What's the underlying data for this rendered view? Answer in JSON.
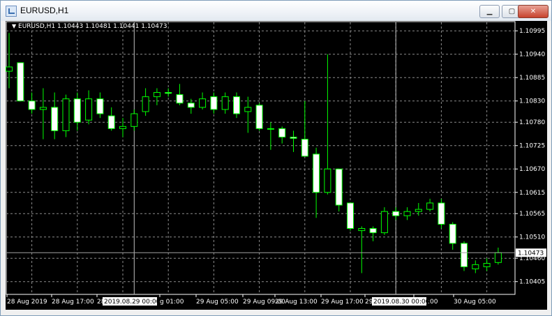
{
  "window": {
    "title": "EURUSD,H1",
    "buttons": {
      "minimize": "▁",
      "maximize": "▢",
      "close": "✕"
    }
  },
  "chart_header": {
    "label": "EURUSD,H1  1.10443 1.10481 1.10441 1.10473"
  },
  "colors": {
    "background": "#000000",
    "grid": "#8c8c8c",
    "bull": "#00ff00",
    "bull_fill": "#000000",
    "bear_fill": "#ffffff",
    "text": "#ffffff"
  },
  "chart_data": {
    "type": "candlestick",
    "symbol": "EURUSD",
    "timeframe": "H1",
    "ylim": [
      1.10375,
      1.11015
    ],
    "y_ticks": [
      "1.10995",
      "1.10940",
      "1.10885",
      "1.10830",
      "1.10780",
      "1.10725",
      "1.10670",
      "1.10615",
      "1.10565",
      "1.10510",
      "1.10460",
      "1.10405"
    ],
    "x_labels": [
      "28 Aug 2019",
      "28 Aug 17:00",
      "28",
      "g 01:00",
      "29 Aug 05:00",
      "29 Aug 09:00",
      "29 Aug 13:00",
      "29 Aug 17:00",
      "29",
      "g 01:00",
      "30 Aug 05:00"
    ],
    "crosshair_labels": [
      "2019.08.29 00:00",
      "2019.08.30 00:00"
    ],
    "current_price": "1.10473",
    "candles": [
      {
        "o": 1.109,
        "h": 1.1099,
        "l": 1.1086,
        "c": 1.1091
      },
      {
        "o": 1.1092,
        "h": 1.1092,
        "l": 1.1083,
        "c": 1.1083
      },
      {
        "o": 1.1083,
        "h": 1.1085,
        "l": 1.108,
        "c": 1.1081
      },
      {
        "o": 1.1081,
        "h": 1.1086,
        "l": 1.1074,
        "c": 1.10815
      },
      {
        "o": 1.10815,
        "h": 1.1085,
        "l": 1.1074,
        "c": 1.1076
      },
      {
        "o": 1.1076,
        "h": 1.10845,
        "l": 1.10745,
        "c": 1.10835
      },
      {
        "o": 1.10835,
        "h": 1.1085,
        "l": 1.1076,
        "c": 1.1078
      },
      {
        "o": 1.10785,
        "h": 1.10855,
        "l": 1.10775,
        "c": 1.10835
      },
      {
        "o": 1.10835,
        "h": 1.1085,
        "l": 1.1079,
        "c": 1.108
      },
      {
        "o": 1.10795,
        "h": 1.10815,
        "l": 1.1076,
        "c": 1.10765
      },
      {
        "o": 1.10765,
        "h": 1.1079,
        "l": 1.10745,
        "c": 1.1077
      },
      {
        "o": 1.1077,
        "h": 1.1081,
        "l": 1.1076,
        "c": 1.108
      },
      {
        "o": 1.10805,
        "h": 1.1086,
        "l": 1.10795,
        "c": 1.1084
      },
      {
        "o": 1.1084,
        "h": 1.1086,
        "l": 1.1082,
        "c": 1.1085
      },
      {
        "o": 1.1085,
        "h": 1.1086,
        "l": 1.1084,
        "c": 1.10848
      },
      {
        "o": 1.10845,
        "h": 1.1087,
        "l": 1.1082,
        "c": 1.10825
      },
      {
        "o": 1.10825,
        "h": 1.10835,
        "l": 1.108,
        "c": 1.10815
      },
      {
        "o": 1.10815,
        "h": 1.1085,
        "l": 1.1081,
        "c": 1.10835
      },
      {
        "o": 1.1084,
        "h": 1.1085,
        "l": 1.108,
        "c": 1.1081
      },
      {
        "o": 1.1081,
        "h": 1.1085,
        "l": 1.108,
        "c": 1.1084
      },
      {
        "o": 1.1084,
        "h": 1.1085,
        "l": 1.1079,
        "c": 1.108
      },
      {
        "o": 1.10805,
        "h": 1.1084,
        "l": 1.10755,
        "c": 1.10815
      },
      {
        "o": 1.1082,
        "h": 1.10825,
        "l": 1.1076,
        "c": 1.10765
      },
      {
        "o": 1.10765,
        "h": 1.1078,
        "l": 1.10715,
        "c": 1.10765
      },
      {
        "o": 1.10765,
        "h": 1.1077,
        "l": 1.1073,
        "c": 1.10745
      },
      {
        "o": 1.10745,
        "h": 1.1076,
        "l": 1.1071,
        "c": 1.10742
      },
      {
        "o": 1.1074,
        "h": 1.1083,
        "l": 1.107,
        "c": 1.107
      },
      {
        "o": 1.10705,
        "h": 1.1072,
        "l": 1.10555,
        "c": 1.10615
      },
      {
        "o": 1.10615,
        "h": 1.1094,
        "l": 1.1061,
        "c": 1.1067
      },
      {
        "o": 1.1067,
        "h": 1.1067,
        "l": 1.1057,
        "c": 1.10585
      },
      {
        "o": 1.1059,
        "h": 1.1059,
        "l": 1.10525,
        "c": 1.1053
      },
      {
        "o": 1.10525,
        "h": 1.10535,
        "l": 1.10425,
        "c": 1.1053
      },
      {
        "o": 1.1053,
        "h": 1.10535,
        "l": 1.105,
        "c": 1.1052
      },
      {
        "o": 1.1052,
        "h": 1.1058,
        "l": 1.10515,
        "c": 1.1057
      },
      {
        "o": 1.1057,
        "h": 1.1058,
        "l": 1.1055,
        "c": 1.1056
      },
      {
        "o": 1.1056,
        "h": 1.1058,
        "l": 1.1055,
        "c": 1.1057
      },
      {
        "o": 1.1057,
        "h": 1.1059,
        "l": 1.1056,
        "c": 1.10575
      },
      {
        "o": 1.10575,
        "h": 1.106,
        "l": 1.1057,
        "c": 1.1059
      },
      {
        "o": 1.1059,
        "h": 1.106,
        "l": 1.1053,
        "c": 1.1054
      },
      {
        "o": 1.1054,
        "h": 1.10545,
        "l": 1.1048,
        "c": 1.10495
      },
      {
        "o": 1.10495,
        "h": 1.105,
        "l": 1.1043,
        "c": 1.1044
      },
      {
        "o": 1.10435,
        "h": 1.10455,
        "l": 1.10425,
        "c": 1.10445
      },
      {
        "o": 1.1044,
        "h": 1.1046,
        "l": 1.1043,
        "c": 1.10448
      },
      {
        "o": 1.1045,
        "h": 1.10485,
        "l": 1.10445,
        "c": 1.10473
      }
    ]
  }
}
